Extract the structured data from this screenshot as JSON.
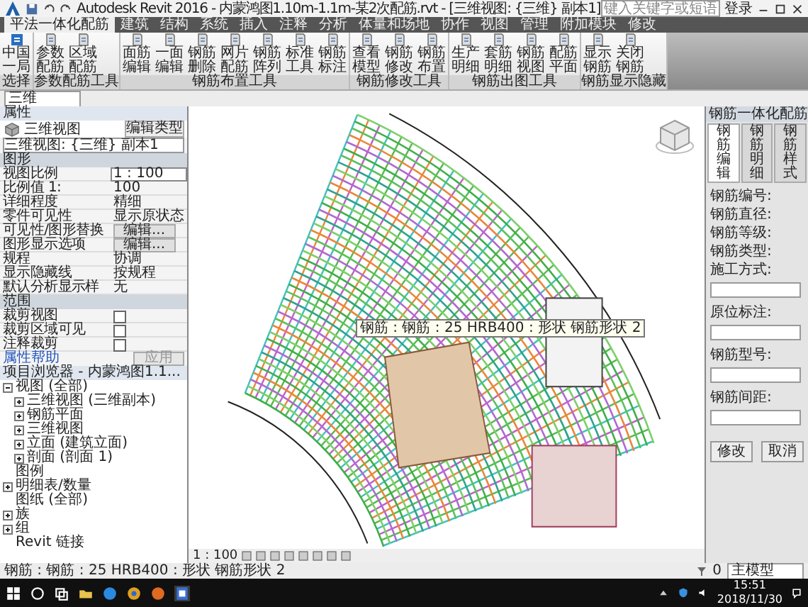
{
  "title_bar": {
    "title": "Autodesk Revit 2016 - 内蒙鸿图1.10m-1.1m-某2次配筋.rvt - [三维视图: {三维} 副本1]",
    "search": {
      "placeholder": "键入关键字或短语"
    },
    "sign_in": "登录"
  },
  "ribbon": {
    "tabs": [
      {
        "label": "平法一体化配筋",
        "selected": true
      },
      {
        "label": "建筑",
        "selected": false
      },
      {
        "label": "结构",
        "selected": false
      },
      {
        "label": "系统",
        "selected": false
      },
      {
        "label": "插入",
        "selected": false
      },
      {
        "label": "注释",
        "selected": false
      },
      {
        "label": "分析",
        "selected": false
      },
      {
        "label": "体量和场地",
        "selected": false
      },
      {
        "label": "协作",
        "selected": false
      },
      {
        "label": "视图",
        "selected": false
      },
      {
        "label": "管理",
        "selected": false
      },
      {
        "label": "附加模块",
        "selected": false
      },
      {
        "label": "修改",
        "selected": false
      }
    ],
    "panels": [
      {
        "label": "选择",
        "buttons": [
          "中国一局"
        ]
      },
      {
        "label": "参数配筋工具",
        "buttons": [
          "参数配筋",
          "区域配筋"
        ]
      },
      {
        "label": "钢筋布置工具",
        "buttons": [
          "面筋编辑",
          "一面编辑",
          "钢筋删除",
          "网片配筋",
          "钢筋阵列",
          "标准工具",
          "钢筋标注"
        ]
      },
      {
        "label": "钢筋修改工具",
        "buttons": [
          "查看模型",
          "钢筋修改",
          "钢筋布置"
        ]
      },
      {
        "label": "钢筋出图工具",
        "buttons": [
          "生产明细",
          "套筋明细",
          "钢筋视图",
          "配筋平面"
        ]
      },
      {
        "label": "钢筋显示隐藏",
        "buttons": [
          "显示钢筋",
          "关闭钢筋"
        ]
      }
    ]
  },
  "view_selector": {
    "value": "三维"
  },
  "properties": {
    "title": "属性",
    "type_name": "三维视图",
    "instance": "三维视图: {三维} 副本1",
    "edit_type": "编辑类型",
    "groups": [
      {
        "label": "图形",
        "rows": [
          {
            "label": "视图比例",
            "kind": "field",
            "value": "1 : 100"
          },
          {
            "label": "比例值 1:",
            "kind": "text",
            "value": "100"
          },
          {
            "label": "详细程度",
            "kind": "text",
            "value": "精细"
          },
          {
            "label": "零件可见性",
            "kind": "text",
            "value": "显示原状态"
          },
          {
            "label": "可见性/图形替换",
            "kind": "button",
            "value": "编辑..."
          },
          {
            "label": "图形显示选项",
            "kind": "button",
            "value": "编辑..."
          },
          {
            "label": "规程",
            "kind": "text",
            "value": "协调"
          },
          {
            "label": "显示隐藏线",
            "kind": "text",
            "value": "按规程"
          },
          {
            "label": "默认分析显示样",
            "kind": "text",
            "value": "无"
          }
        ]
      },
      {
        "label": "范围",
        "rows": [
          {
            "label": "裁剪视图",
            "kind": "checkbox",
            "checked": false
          },
          {
            "label": "裁剪区域可见",
            "kind": "checkbox",
            "checked": false
          },
          {
            "label": "注释裁剪",
            "kind": "checkbox",
            "checked": false
          }
        ]
      }
    ],
    "help_link": "属性帮助",
    "apply": "应用"
  },
  "project_browser": {
    "title": "项目浏览器 - 内蒙鸿图1.1...",
    "tree": [
      {
        "label": "视图 (全部)",
        "expanded": true,
        "children": [
          {
            "label": "三维视图 (三维副本)",
            "expanded": false
          },
          {
            "label": "钢筋平面",
            "expanded": false
          },
          {
            "label": "三维视图",
            "expanded": false
          },
          {
            "label": "立面 (建筑立面)",
            "expanded": false
          },
          {
            "label": "剖面 (剖面 1)",
            "expanded": false
          }
        ]
      },
      {
        "label": "图例"
      },
      {
        "label": "明细表/数量",
        "expanded": false
      },
      {
        "label": "图纸 (全部)"
      },
      {
        "label": "族",
        "expanded": false
      },
      {
        "label": "组",
        "expanded": false
      },
      {
        "label": "Revit 链接"
      }
    ]
  },
  "viewport": {
    "tooltip": "钢筋 : 钢筋 : 25 HRB400 : 形状 钢筋形状 2",
    "scale": "1 : 100"
  },
  "rebar_panel": {
    "title": "钢筋一体化配筋",
    "tabs": [
      {
        "label": "钢筋编辑",
        "selected": true
      },
      {
        "label": "钢筋明细",
        "selected": false
      },
      {
        "label": "钢筋样式",
        "selected": false
      }
    ],
    "fields": [
      {
        "label": "钢筋编号:",
        "kind": "text"
      },
      {
        "label": "钢筋直径:",
        "kind": "text"
      },
      {
        "label": "钢筋等级:",
        "kind": "text"
      },
      {
        "label": "钢筋类型:",
        "kind": "text"
      },
      {
        "label": "施工方式:",
        "kind": "input"
      },
      {
        "label": "原位标注:",
        "kind": "input"
      },
      {
        "label": "钢筋型号:",
        "kind": "input"
      },
      {
        "label": "钢筋间距:",
        "kind": "input"
      }
    ],
    "buttons": [
      "修改",
      "取消"
    ]
  },
  "status_bar": {
    "message": "钢筋 : 钢筋 : 25 HRB400 : 形状 钢筋形状 2",
    "count": "0",
    "model": "主模型"
  },
  "taskbar": {
    "time": "15:51",
    "date": "2018/11/30"
  }
}
